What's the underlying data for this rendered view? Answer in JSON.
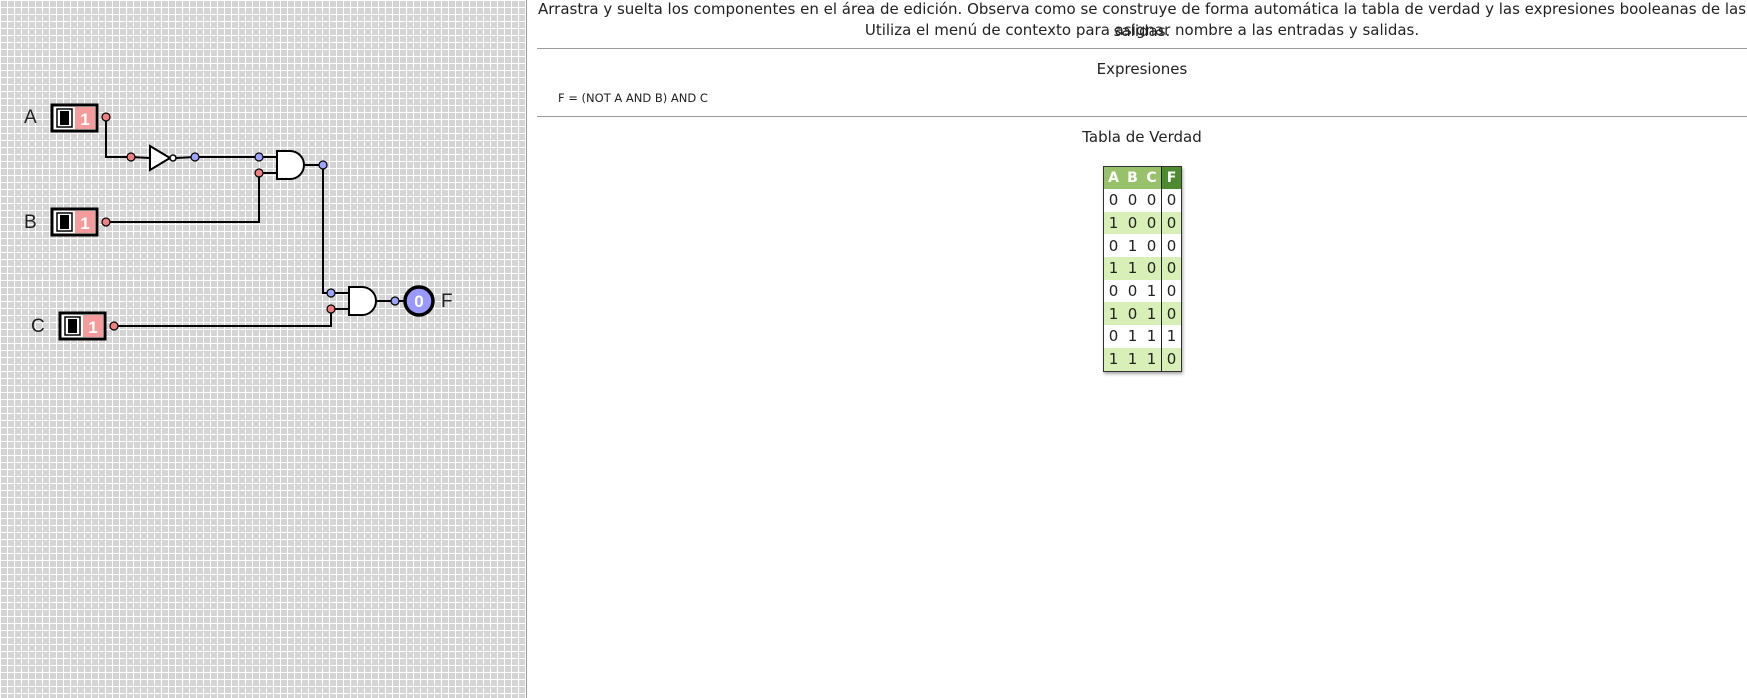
{
  "editor": {
    "inputs": [
      {
        "name": "A",
        "value": "1"
      },
      {
        "name": "B",
        "value": "1"
      },
      {
        "name": "C",
        "value": "1"
      }
    ],
    "output": {
      "name": "F",
      "value": "0"
    }
  },
  "instructions": {
    "line1": "Arrastra y suelta los componentes en el área de edición. Observa como se construye de forma automática la tabla de verdad y las expresiones booleanas de las salidas.",
    "line2": "Utiliza el menú de contexto para asignar nombre a las entradas y salidas."
  },
  "expressions": {
    "title": "Expresiones",
    "items": [
      "F = (NOT A AND B) AND C"
    ]
  },
  "truth_table": {
    "title": "Tabla de Verdad",
    "headers": [
      "A",
      "B",
      "C",
      "F"
    ],
    "rows": [
      [
        "0",
        "0",
        "0",
        "0"
      ],
      [
        "1",
        "0",
        "0",
        "0"
      ],
      [
        "0",
        "1",
        "0",
        "0"
      ],
      [
        "1",
        "1",
        "0",
        "0"
      ],
      [
        "0",
        "0",
        "1",
        "0"
      ],
      [
        "1",
        "0",
        "1",
        "0"
      ],
      [
        "0",
        "1",
        "1",
        "1"
      ],
      [
        "1",
        "1",
        "1",
        "0"
      ]
    ]
  },
  "colors": {
    "input_true_fill": "#f59b9b",
    "output_fill": "#9999ff",
    "pin_input": "#f08080",
    "pin_output": "#9fa2ff",
    "header_green": "#97c26a",
    "header_dark_green": "#4e8a30",
    "row_stripe": "#d8f0b8"
  }
}
